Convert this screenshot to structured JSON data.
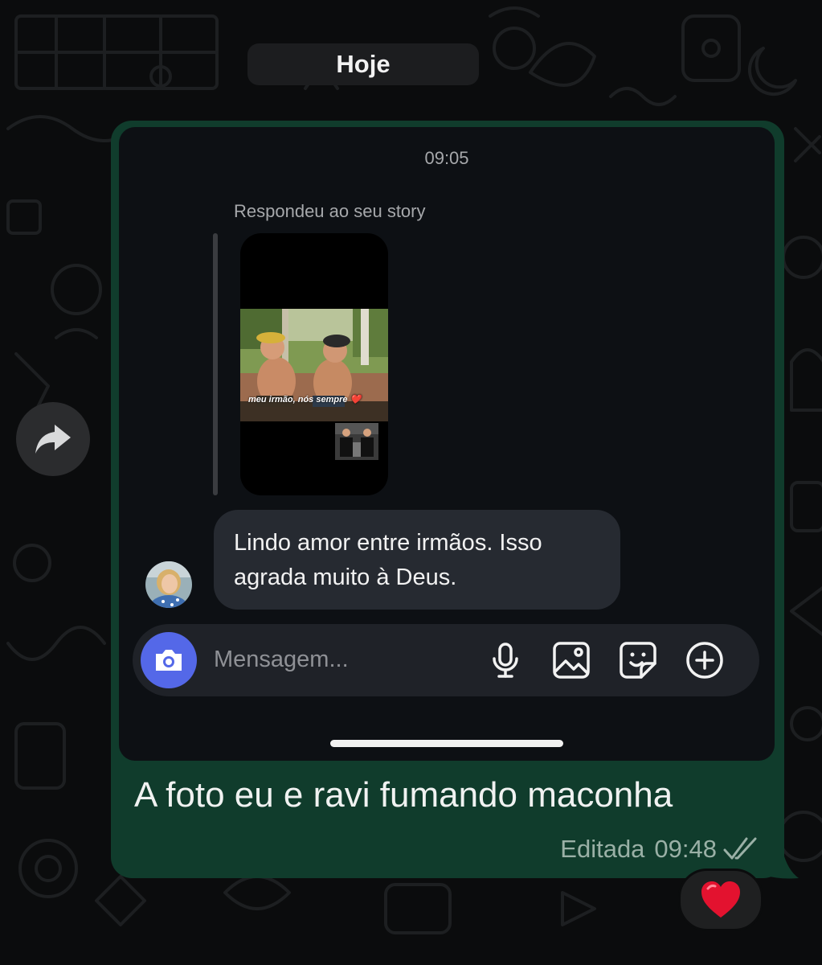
{
  "date_separator": "Hoje",
  "screenshot": {
    "time": "09:05",
    "story_reply_label": "Respondeu ao seu story",
    "story_caption": "meu irmão, nós sempre ❤️",
    "reply_message_line1": "Lindo amor entre irmãos. Isso",
    "reply_message_line2": "agrada muito à Deus.",
    "composer": {
      "placeholder": "Mensagem...",
      "icons": [
        "camera-icon",
        "microphone-icon",
        "gallery-icon",
        "sticker-icon",
        "plus-icon"
      ]
    }
  },
  "message": {
    "text": "A foto eu e ravi fumando maconha",
    "edited_label": "Editada",
    "time": "09:48",
    "status": "read"
  },
  "reaction": "❤️",
  "colors": {
    "background": "#0b0c0d",
    "outgoing_bubble": "#103c2c",
    "camera_button": "#5468e8",
    "read_ticks": "#9ab0a6"
  }
}
